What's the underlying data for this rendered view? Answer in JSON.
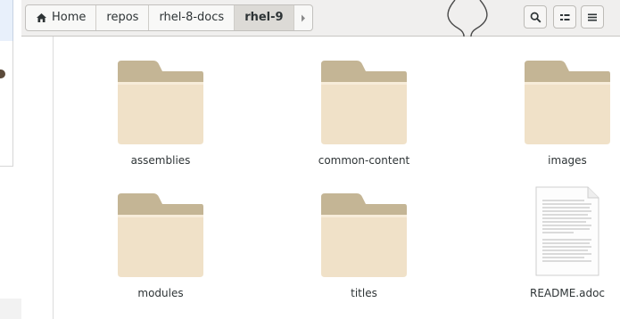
{
  "breadcrumbs": [
    {
      "label": "Home",
      "icon": "home-icon"
    },
    {
      "label": "repos"
    },
    {
      "label": "rhel-8-docs"
    },
    {
      "label": "rhel-9",
      "active": true
    }
  ],
  "toolbar": {
    "search_icon": "search-icon",
    "view_icon": "list-view-icon",
    "menu_icon": "hamburger-menu-icon"
  },
  "files": [
    {
      "name": "assemblies",
      "type": "folder"
    },
    {
      "name": "common-content",
      "type": "folder"
    },
    {
      "name": "images",
      "type": "folder"
    },
    {
      "name": "modules",
      "type": "folder"
    },
    {
      "name": "titles",
      "type": "folder"
    },
    {
      "name": "README.adoc",
      "type": "document"
    }
  ],
  "colors": {
    "folder_back": "#c4b595",
    "folder_front": "#f0e1c8",
    "header_bg": "#f0efee"
  }
}
